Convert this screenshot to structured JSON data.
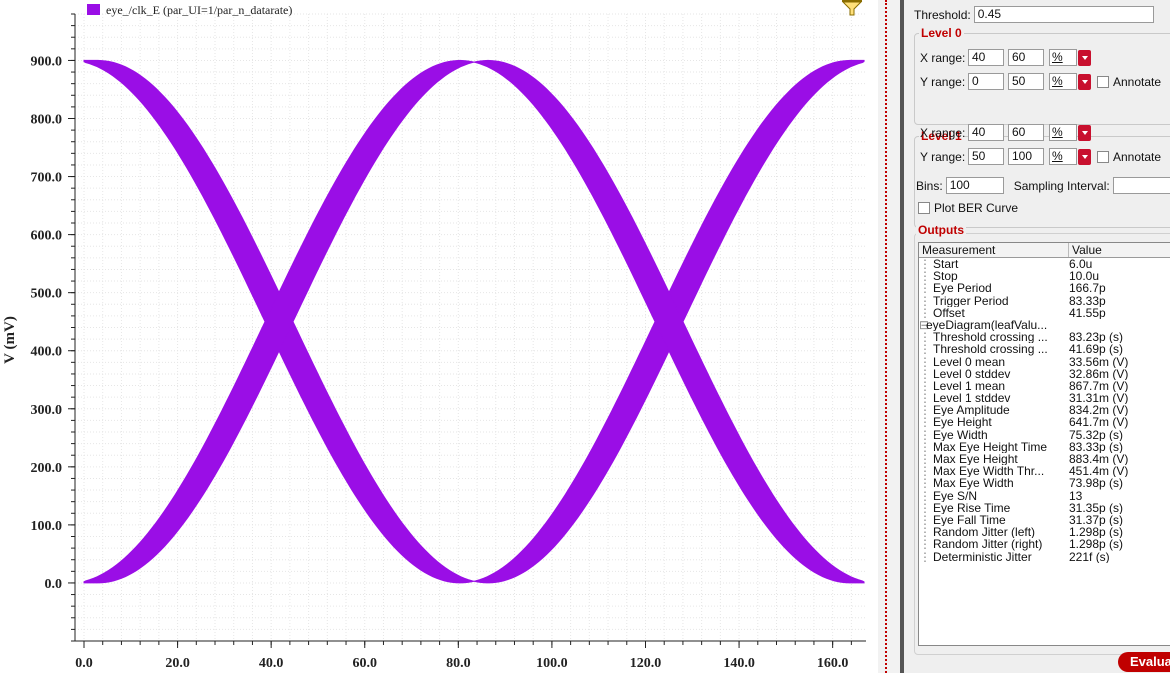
{
  "plot": {
    "legend": "eye_/clk_E (par_UI=1/par_n_datarate)",
    "ylabel": "V (mV)",
    "trace_color": "#9a0ee6",
    "filter_icon": "funnel-icon"
  },
  "chart_data": {
    "type": "line",
    "title": "",
    "xlabel": "",
    "ylabel": "V (mV)",
    "xlim": [
      0,
      166.7
    ],
    "ylim": [
      -100,
      980
    ],
    "x_ticks": [
      "0.0",
      "20.0",
      "40.0",
      "60.0",
      "80.0",
      "100.0",
      "120.0",
      "140.0",
      "160.0"
    ],
    "y_ticks": [
      "0.0",
      "100.0",
      "200.0",
      "300.0",
      "400.0",
      "500.0",
      "600.0",
      "700.0",
      "800.0",
      "900.0"
    ],
    "grid": true,
    "legend_position": "top-left",
    "series": [
      {
        "name": "eye_/clk_E (par_UI=1/par_n_datarate)",
        "kind": "eye-diagram band",
        "period": 166.7,
        "low": 0,
        "high": 900,
        "crossings_x": [
          41.7,
          125.0
        ],
        "crossing_y": 451.4,
        "band_width_x": 6
      }
    ]
  },
  "panel": {
    "threshold": {
      "label": "Threshold:",
      "value": "0.45"
    },
    "level0": {
      "title": "Level 0",
      "xrange": {
        "label": "X range:",
        "from": "40",
        "to": "60",
        "unit": "%"
      },
      "yrange": {
        "label": "Y range:",
        "from": "0",
        "to": "50",
        "unit": "%"
      },
      "annotate": "Annotate"
    },
    "level1": {
      "title": "Level 1",
      "xrange": {
        "label": "X range:",
        "from": "40",
        "to": "60",
        "unit": "%"
      },
      "yrange": {
        "label": "Y range:",
        "from": "50",
        "to": "100",
        "unit": "%"
      },
      "annotate": "Annotate"
    },
    "bins": {
      "label": "Bins:",
      "value": "100"
    },
    "sampling": {
      "label": "Sampling Interval:",
      "value": ""
    },
    "plot_ber": "Plot BER Curve",
    "outputs_title": "Outputs",
    "table": {
      "headers": [
        "Measurement",
        "Value"
      ],
      "rows": [
        {
          "name": "Start",
          "value": "6.0u",
          "indent": 1
        },
        {
          "name": "Stop",
          "value": "10.0u",
          "indent": 1
        },
        {
          "name": "Eye Period",
          "value": "166.7p",
          "indent": 1
        },
        {
          "name": "Trigger Period",
          "value": "83.33p",
          "indent": 1
        },
        {
          "name": "Offset",
          "value": "41.55p",
          "indent": 1
        },
        {
          "name": "eyeDiagram(leafValu...",
          "value": "",
          "indent": 0
        },
        {
          "name": "Threshold crossing ...",
          "value": "83.23p (s)",
          "indent": 1
        },
        {
          "name": "Threshold crossing ...",
          "value": "41.69p (s)",
          "indent": 1
        },
        {
          "name": "Level 0 mean",
          "value": "33.56m (V)",
          "indent": 1
        },
        {
          "name": "Level 0 stddev",
          "value": "32.86m (V)",
          "indent": 1
        },
        {
          "name": "Level 1 mean",
          "value": "867.7m (V)",
          "indent": 1
        },
        {
          "name": "Level 1 stddev",
          "value": "31.31m (V)",
          "indent": 1
        },
        {
          "name": "Eye Amplitude",
          "value": "834.2m (V)",
          "indent": 1
        },
        {
          "name": "Eye Height",
          "value": "641.7m (V)",
          "indent": 1
        },
        {
          "name": "Eye Width",
          "value": "75.32p (s)",
          "indent": 1
        },
        {
          "name": "Max Eye Height Time",
          "value": "83.33p (s)",
          "indent": 1
        },
        {
          "name": "Max Eye Height",
          "value": "883.4m (V)",
          "indent": 1
        },
        {
          "name": "Max Eye Width Thr...",
          "value": "451.4m (V)",
          "indent": 1
        },
        {
          "name": "Max Eye Width",
          "value": "73.98p (s)",
          "indent": 1
        },
        {
          "name": "Eye S/N",
          "value": "13",
          "indent": 1
        },
        {
          "name": "Eye Rise Time",
          "value": "31.35p (s)",
          "indent": 1
        },
        {
          "name": "Eye Fall Time",
          "value": "31.37p (s)",
          "indent": 1
        },
        {
          "name": "Random Jitter (left)",
          "value": "1.298p (s)",
          "indent": 1
        },
        {
          "name": "Random Jitter (right)",
          "value": "1.298p (s)",
          "indent": 1
        },
        {
          "name": "Deterministic Jitter",
          "value": "221f (s)",
          "indent": 1
        }
      ]
    },
    "evaluate_label": "Evaluate"
  }
}
